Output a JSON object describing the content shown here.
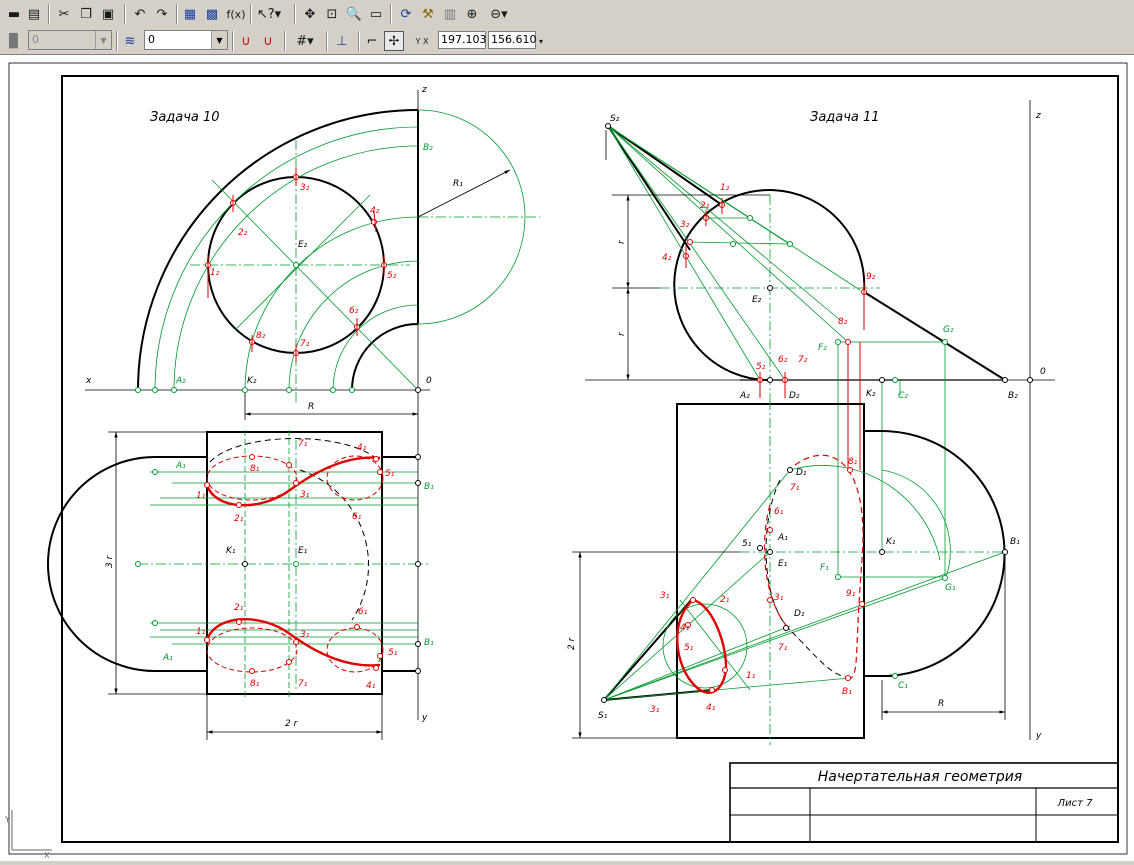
{
  "toolbar": {
    "layer_value": "0",
    "style_value": "0",
    "coord_label": "Y X",
    "coord_x": "197.103",
    "coord_y": "156.610",
    "fx_label": "f(x)"
  },
  "drawing": {
    "task10": "Задача 10",
    "task11": "Задача 11",
    "title_block": {
      "title": "Начертательная геометрия",
      "sheet": "Лист 7"
    },
    "colors": {
      "frame": "#000000",
      "construction": "#009a2e",
      "curve": "#e00000",
      "circle": "#000000"
    },
    "left_top_labels": {
      "z": "z",
      "x": "x",
      "o": "0",
      "R1": "R₁",
      "R": "R",
      "B2": "B₂",
      "A2": "A₂",
      "K2": "K₂",
      "E2": "E₂",
      "p1": "1₂",
      "p2": "2₂",
      "p3": "3₂",
      "p4": "4₂",
      "p5": "5₂",
      "p6": "6₂",
      "p7": "7₂",
      "p8": "8₂"
    },
    "left_bottom_labels": {
      "y": "y",
      "dim_3r": "3 r",
      "dim_2r": "2 r",
      "A1a": "A₁",
      "A1b": "A₁",
      "B1a": "B₁",
      "B1b": "B₁",
      "K1": "K₁",
      "E1": "E₁",
      "t1a": "1₁",
      "t2a": "2₁",
      "t3a": "3₁",
      "t4a": "4₁",
      "t5a": "5₁",
      "t6a": "6₁",
      "t7a": "7₁",
      "t8a": "8₁",
      "t1b": "1₁",
      "t2b": "2₁",
      "t3b": "3₁",
      "t4b": "4₁",
      "t5b": "5₁",
      "t6b": "6₁",
      "t7b": "7₁",
      "t8b": "8₁"
    },
    "right_top_labels": {
      "z": "z",
      "o": "0",
      "S2": "S₂",
      "E2": "E₂",
      "r1": "r",
      "r2": "r",
      "A2": "A₂",
      "B2": "B₂",
      "C2": "C₂",
      "D2": "D₂",
      "F2": "F₂",
      "G2": "G₂",
      "K2": "K₂",
      "p1": "1₂",
      "p2": "2₂",
      "p3": "3₂",
      "p4": "4₂",
      "p5": "5₂",
      "p6": "6₂",
      "p7": "7₂",
      "p8": "8₂",
      "p9": "9₂"
    },
    "right_bottom_labels": {
      "y": "y",
      "dim_2r": "2 r",
      "R": "R",
      "S1": "S₁",
      "E1": "E₁",
      "A1": "A₁",
      "B1a": "B₁",
      "B1b": "B₁",
      "C1": "C₁",
      "D1a": "D₁",
      "D1b": "D₁",
      "F1": "F₁",
      "G1": "G₁",
      "K1": "K₁",
      "q1": "1₁",
      "q2": "2₁",
      "q3": "3₁",
      "q4": "4₁",
      "q5": "5₁",
      "q6": "6₁",
      "q7": "7₁",
      "q8": "8₁",
      "q9": "9₁",
      "q3b": "3₁",
      "q4b": "4₁",
      "q7b": "7₁"
    }
  }
}
